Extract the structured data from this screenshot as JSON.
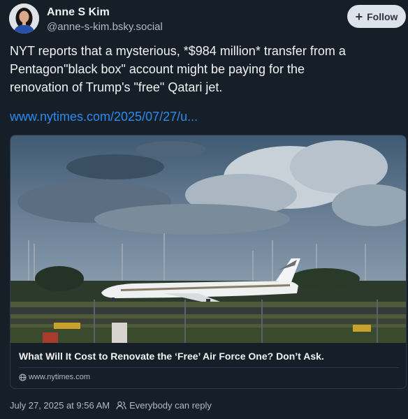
{
  "author": {
    "name": "Anne S Kim",
    "handle": "@anne-s-kim.bsky.social"
  },
  "follow_button": {
    "label": "Follow",
    "icon": "plus-icon"
  },
  "post": {
    "text": "NYT reports that a mysterious, *$984 million* transfer from a\nPentagon\"black box\" account might be paying for the\nrenovation of Trump's \"free\" Qatari jet.",
    "link_text": "www.nytimes.com/2025/07/27/u..."
  },
  "link_card": {
    "title": "What Will It Cost to Renovate the ‘Free’ Air Force One? Don’t Ask.",
    "domain": "www.nytimes.com",
    "domain_icon": "globe-icon",
    "image_description_icon": "airplane-photo"
  },
  "footer": {
    "timestamp": "July 27, 2025 at 9:56 AM",
    "reply_setting": "Everybody can reply",
    "reply_icon": "people-icon"
  },
  "colors": {
    "background": "#161e27",
    "link": "#2a8cf0",
    "muted": "#aebbc9",
    "follow_bg": "#dde3ea"
  }
}
